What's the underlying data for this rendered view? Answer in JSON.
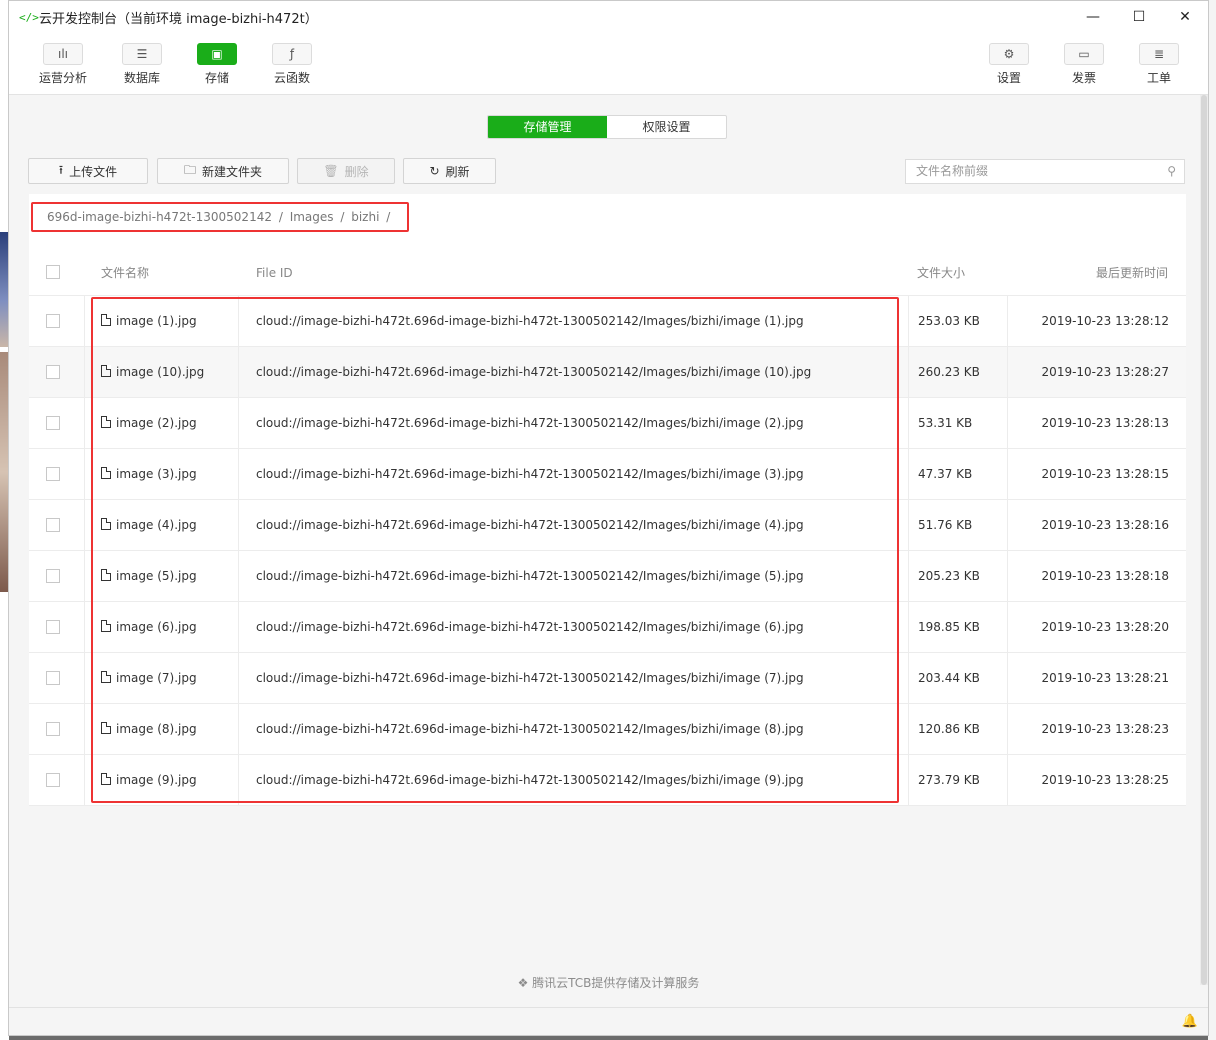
{
  "window": {
    "title": "云开发控制台（当前环境 image-bizhi-h472t）",
    "logo": "</>",
    "minimize": "—",
    "maximize": "☐",
    "close": "✕"
  },
  "toolbar": {
    "left": [
      {
        "label": "运营分析",
        "icon": "chart-icon",
        "glyph": "ılı"
      },
      {
        "label": "数据库",
        "icon": "database-icon",
        "glyph": "☰"
      },
      {
        "label": "存储",
        "icon": "storage-icon",
        "glyph": "▣"
      },
      {
        "label": "云函数",
        "icon": "function-icon",
        "glyph": "ƒ"
      }
    ],
    "right": [
      {
        "label": "设置",
        "icon": "gear-icon",
        "glyph": "⚙"
      },
      {
        "label": "发票",
        "icon": "invoice-icon",
        "glyph": "▭"
      },
      {
        "label": "工单",
        "icon": "ticket-icon",
        "glyph": "≣"
      }
    ]
  },
  "tabs": {
    "storage_manage": "存储管理",
    "permission": "权限设置"
  },
  "actions": {
    "upload": "上传文件",
    "new_folder": "新建文件夹",
    "delete": "删除",
    "refresh": "刷新"
  },
  "search": {
    "placeholder": "文件名称前缀",
    "icon": "search-icon"
  },
  "breadcrumb": [
    "696d-image-bizhi-h472t-1300502142",
    "/",
    "Images",
    "/",
    "bizhi",
    "/"
  ],
  "table": {
    "headers": {
      "name": "文件名称",
      "file_id": "File ID",
      "size": "文件大小",
      "updated": "最后更新时间"
    },
    "rows": [
      {
        "name": "image (1).jpg",
        "file_id": "cloud://image-bizhi-h472t.696d-image-bizhi-h472t-1300502142/Images/bizhi/image (1).jpg",
        "size": "253.03 KB",
        "updated": "2019-10-23 13:28:12"
      },
      {
        "name": "image (10).jpg",
        "file_id": "cloud://image-bizhi-h472t.696d-image-bizhi-h472t-1300502142/Images/bizhi/image (10).jpg",
        "size": "260.23 KB",
        "updated": "2019-10-23 13:28:27"
      },
      {
        "name": "image (2).jpg",
        "file_id": "cloud://image-bizhi-h472t.696d-image-bizhi-h472t-1300502142/Images/bizhi/image (2).jpg",
        "size": "53.31 KB",
        "updated": "2019-10-23 13:28:13"
      },
      {
        "name": "image (3).jpg",
        "file_id": "cloud://image-bizhi-h472t.696d-image-bizhi-h472t-1300502142/Images/bizhi/image (3).jpg",
        "size": "47.37 KB",
        "updated": "2019-10-23 13:28:15"
      },
      {
        "name": "image (4).jpg",
        "file_id": "cloud://image-bizhi-h472t.696d-image-bizhi-h472t-1300502142/Images/bizhi/image (4).jpg",
        "size": "51.76 KB",
        "updated": "2019-10-23 13:28:16"
      },
      {
        "name": "image (5).jpg",
        "file_id": "cloud://image-bizhi-h472t.696d-image-bizhi-h472t-1300502142/Images/bizhi/image (5).jpg",
        "size": "205.23 KB",
        "updated": "2019-10-23 13:28:18"
      },
      {
        "name": "image (6).jpg",
        "file_id": "cloud://image-bizhi-h472t.696d-image-bizhi-h472t-1300502142/Images/bizhi/image (6).jpg",
        "size": "198.85 KB",
        "updated": "2019-10-23 13:28:20"
      },
      {
        "name": "image (7).jpg",
        "file_id": "cloud://image-bizhi-h472t.696d-image-bizhi-h472t-1300502142/Images/bizhi/image (7).jpg",
        "size": "203.44 KB",
        "updated": "2019-10-23 13:28:21"
      },
      {
        "name": "image (8).jpg",
        "file_id": "cloud://image-bizhi-h472t.696d-image-bizhi-h472t-1300502142/Images/bizhi/image (8).jpg",
        "size": "120.86 KB",
        "updated": "2019-10-23 13:28:23"
      },
      {
        "name": "image (9).jpg",
        "file_id": "cloud://image-bizhi-h472t.696d-image-bizhi-h472t-1300502142/Images/bizhi/image (9).jpg",
        "size": "273.79 KB",
        "updated": "2019-10-23 13:28:25"
      }
    ]
  },
  "footer": {
    "text": "腾讯云TCB提供存储及计算服务"
  },
  "colors": {
    "accent": "#1aad19",
    "highlight": "#e33333"
  }
}
